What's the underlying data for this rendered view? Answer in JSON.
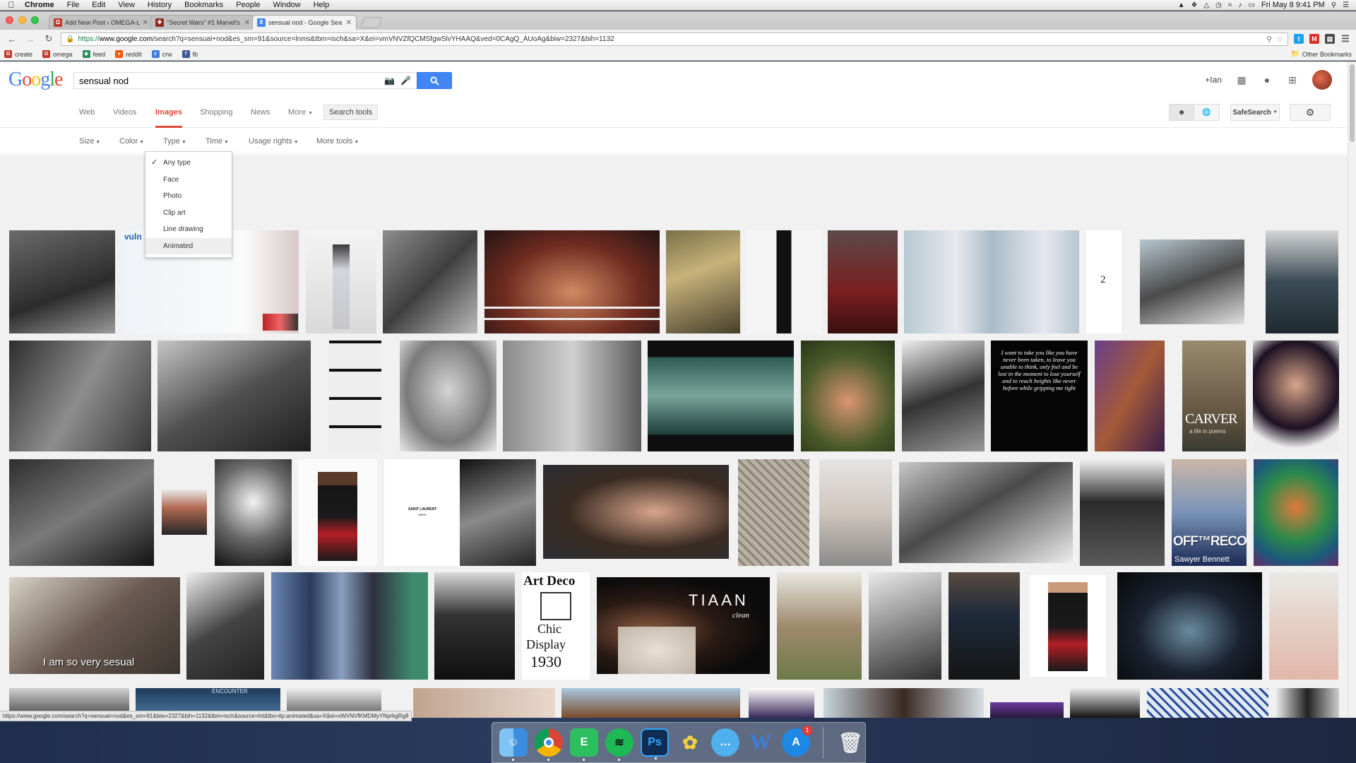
{
  "menubar": {
    "app": "Chrome",
    "items": [
      "File",
      "Edit",
      "View",
      "History",
      "Bookmarks",
      "People",
      "Window",
      "Help"
    ],
    "clock": "Fri May 8  9:41 PM",
    "user": "Ian"
  },
  "tabs": [
    {
      "title": "Add New Post ‹ OMEGA-L",
      "favicon_color": "#c0392b",
      "favicon_glyph": "Ω"
    },
    {
      "title": "\"Secret Wars\" #1 Marvel's",
      "favicon_color": "#8e2b1f",
      "favicon_glyph": "❖"
    },
    {
      "title": "sensual nod - Google Sea",
      "favicon_color": "#4285f4",
      "favicon_glyph": "8"
    }
  ],
  "omnibox": {
    "url_scheme": "https://",
    "url_host": "www.google.com",
    "url_rest": "/search?q=sensual+nod&es_sm=91&source=lnms&tbm=isch&sa=X&ei=vmVNVZfQCMSfgwSlvYHAAQ&ved=0CAgQ_AUoAg&biw=2327&bih=1132"
  },
  "bookmarks": [
    {
      "label": "create",
      "color": "#c0392b",
      "glyph": "Ω"
    },
    {
      "label": "omega",
      "color": "#c0392b",
      "glyph": "Ω"
    },
    {
      "label": "feed",
      "color": "#2e8b57",
      "glyph": "◆"
    },
    {
      "label": "reddit",
      "color": "#ff5700",
      "glyph": "●"
    },
    {
      "label": "crw",
      "color": "#3b7ddd",
      "glyph": "c"
    },
    {
      "label": "fb",
      "color": "#3b5998",
      "glyph": "f"
    }
  ],
  "other_bookmarks": "Other Bookmarks",
  "google": {
    "logo": "Google",
    "query": "sensual nod",
    "plus_user": "+Ian",
    "nav": [
      "Web",
      "Videos",
      "Images",
      "Shopping",
      "News",
      "More"
    ],
    "active_tab": "Images",
    "search_tools": "Search tools",
    "safesearch": "SafeSearch",
    "tools": [
      "Size",
      "Color",
      "Type",
      "Time",
      "Usage rights",
      "More tools"
    ],
    "type_menu": {
      "items": [
        "Any type",
        "Face",
        "Photo",
        "Clip art",
        "Line drawing",
        "Animated"
      ],
      "checked": "Any type",
      "hovered": "Animated"
    }
  },
  "image_text": {
    "vuln": "vuln",
    "two": "2",
    "quote": "I want to take you like you have never been taken, to leave you unable to think, only feel and be lost in the moment to lose yourself and to reach heights like never before while gripping me tight",
    "carver": "CARVER",
    "carver_sub": "a life in poems",
    "saint_laurent": "SAINT LAURENT",
    "saint_laurent_sub": "PARIS",
    "off_record": "OFF™RECORD",
    "sawyer": "Sawyer Bennett",
    "caption": "I am so very sesual",
    "artdeco": [
      "Art Deco",
      "Chic",
      "Display",
      "1930"
    ],
    "tiaan": "TIAAN",
    "tiaan_sub": "clean",
    "encounter": "ENCOUNTER"
  },
  "status_url": "https://www.google.com/search?q=sensual+nod&es_sm=91&biw=2327&bih=1132&tbm=isch&source=lnt&tbs=itp:animated&sa=X&ei=xWVNVfKMDMyYNprkgRg8",
  "dock": [
    {
      "name": "finder",
      "color": "#4aa3e8",
      "glyph": "☺"
    },
    {
      "name": "chrome",
      "color": "#db4437",
      "glyph": "◉"
    },
    {
      "name": "evernote",
      "color": "#2dbe60",
      "glyph": "E"
    },
    {
      "name": "spotify",
      "color": "#1db954",
      "glyph": "≋"
    },
    {
      "name": "photoshop",
      "color": "#0f2d52",
      "glyph": "Ps"
    },
    {
      "name": "cyberduck",
      "color": "#f4d03f",
      "glyph": "✿"
    },
    {
      "name": "messages",
      "color": "#4fb0ee",
      "glyph": "…"
    },
    {
      "name": "word",
      "color": "#2b5797",
      "glyph": "W"
    },
    {
      "name": "appstore",
      "color": "#1e88e5",
      "glyph": "A",
      "badge": "1"
    }
  ]
}
